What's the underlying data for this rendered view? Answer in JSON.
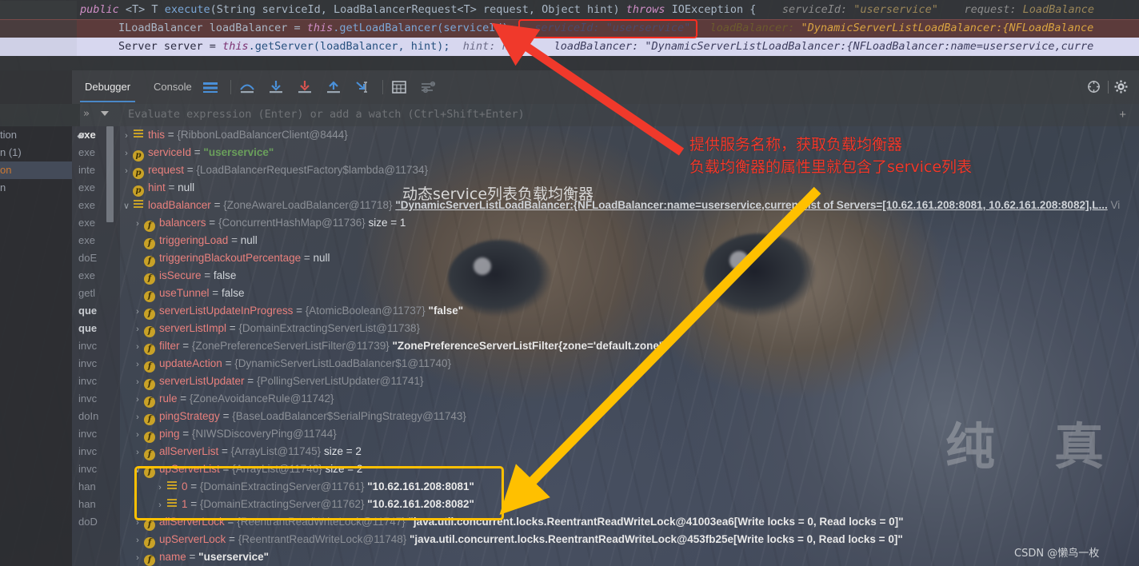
{
  "editor": {
    "line1": {
      "segments": "public <T> T execute(String serviceId, LoadBalancerRequest<T> request, Object hint) throws IOException {",
      "kw1": "public",
      "generic": " <T> T ",
      "method": "execute",
      "params": "(String serviceId, LoadBalancerRequest<T> request, Object hint) ",
      "throws": "throws",
      "tail": " IOException {",
      "inline_hint_1_label": "serviceId:",
      "inline_hint_1_value": "\"userservice\"",
      "inline_hint_2_label": "request:",
      "inline_hint_2_value": "LoadBalance"
    },
    "line2": {
      "type": "ILoadBalancer ",
      "var": "loadBalancer = ",
      "this": "this",
      "call": ".getLoadBalancer(serviceId);",
      "inline_hint_label": "serviceId:",
      "inline_hint_value": "\"userservice\"",
      "inline_hint_2_label": "loadBalancer:",
      "inline_hint_2_value": "\"DynamicServerListLoadBalancer:{NFLoadBalance"
    },
    "line3": {
      "type": "Server ",
      "var": "server = ",
      "this": "this",
      "call": ".getServer(loadBalancer, hint);",
      "hint_label": "hint:",
      "hint_value": "null",
      "lb_label": "loadBalancer:",
      "lb_value": "\"DynamicServerListLoadBalancer:{NFLoadBalancer:name=userservice,curre"
    }
  },
  "toolbar": {
    "tabs": [
      {
        "label": "Debugger",
        "active": true
      },
      {
        "label": "Console",
        "active": false
      }
    ],
    "icons": [
      "frames-icon",
      "step-over-icon",
      "step-into-icon",
      "force-step-into-icon",
      "step-out-icon",
      "run-to-cursor-icon",
      "evaluate-expression-icon",
      "settings-filter-icon"
    ],
    "right_icons": [
      "target-icon",
      "gear-icon"
    ]
  },
  "watchbar": {
    "placeholder": "Evaluate expression (Enter) or add a watch (Ctrl+Shift+Enter)",
    "chevrons": "»",
    "plus": "+"
  },
  "frames_far": [
    {
      "label": "tion",
      "selected": false
    },
    {
      "label": "n (1)",
      "selected": false
    },
    {
      "label": "on",
      "selected": true
    },
    {
      "label": "n",
      "selected": false
    }
  ],
  "frames": [
    {
      "label": "exe",
      "current": true
    },
    {
      "label": "exe",
      "current": false
    },
    {
      "label": "inte",
      "current": false
    },
    {
      "label": "exe",
      "current": false
    },
    {
      "label": "exe",
      "current": false
    },
    {
      "label": "exe",
      "current": false
    },
    {
      "label": "exe",
      "current": false
    },
    {
      "label": "doE",
      "current": false
    },
    {
      "label": "exe",
      "current": false
    },
    {
      "label": "getl",
      "current": false
    },
    {
      "label": "que",
      "current": false,
      "bold": true
    },
    {
      "label": "que",
      "current": false,
      "bold": true
    },
    {
      "label": "invc",
      "current": false
    },
    {
      "label": "invc",
      "current": false
    },
    {
      "label": "invc",
      "current": false
    },
    {
      "label": "invc",
      "current": false
    },
    {
      "label": "doIn",
      "current": false
    },
    {
      "label": "invc",
      "current": false
    },
    {
      "label": "invc",
      "current": false
    },
    {
      "label": "invc",
      "current": false
    },
    {
      "label": "han",
      "current": false
    },
    {
      "label": "han",
      "current": false
    },
    {
      "label": "doD",
      "current": false
    }
  ],
  "variables": [
    {
      "indent": 0,
      "arrow": "›",
      "icon": "object-icon",
      "name": "this",
      "eq": " = ",
      "ref": "{RibbonLoadBalancerClient@8444}",
      "value": "",
      "size": ""
    },
    {
      "indent": 0,
      "arrow": "›",
      "icon": "parameter-icon",
      "name": "serviceId",
      "eq": " = ",
      "ref": "",
      "value": "\"userservice\"",
      "value_style": "green",
      "size": ""
    },
    {
      "indent": 0,
      "arrow": "›",
      "icon": "parameter-icon",
      "name": "request",
      "eq": " = ",
      "ref": "{LoadBalancerRequestFactory$lambda@11734}",
      "value": "",
      "size": ""
    },
    {
      "indent": 0,
      "arrow": "",
      "icon": "parameter-icon",
      "name": "hint",
      "eq": " = ",
      "ref": "",
      "value": "null",
      "value_style": "plain",
      "size": ""
    },
    {
      "indent": 0,
      "arrow": "∨",
      "icon": "object-icon",
      "name": "loadBalancer",
      "eq": " = ",
      "ref": "{ZoneAwareLoadBalancer@11718}",
      "value": "\"DynamicServerListLoadBalancer:{NFLoadBalancer:name=userservice,current list of Servers=[10.62.161.208:8081, 10.62.161.208:8082],L...",
      "value_style": "link",
      "size": "",
      "tail": "Vi"
    },
    {
      "indent": 1,
      "arrow": "›",
      "icon": "field-icon",
      "name": "balancers",
      "eq": " = ",
      "ref": "{ConcurrentHashMap@11736}",
      "value": "",
      "size": "size = 1"
    },
    {
      "indent": 1,
      "arrow": "",
      "icon": "field-icon",
      "name": "triggeringLoad",
      "eq": " = ",
      "ref": "",
      "value": "null",
      "value_style": "plain",
      "size": ""
    },
    {
      "indent": 1,
      "arrow": "",
      "icon": "field-icon",
      "name": "triggeringBlackoutPercentage",
      "eq": " = ",
      "ref": "",
      "value": "null",
      "value_style": "plain",
      "size": ""
    },
    {
      "indent": 1,
      "arrow": "",
      "icon": "field-icon",
      "name": "isSecure",
      "eq": " = ",
      "ref": "",
      "value": "false",
      "value_style": "plain",
      "size": ""
    },
    {
      "indent": 1,
      "arrow": "",
      "icon": "field-icon",
      "name": "useTunnel",
      "eq": " = ",
      "ref": "",
      "value": "false",
      "value_style": "plain",
      "size": ""
    },
    {
      "indent": 1,
      "arrow": "›",
      "icon": "field-icon",
      "name": "serverListUpdateInProgress",
      "eq": " = ",
      "ref": "{AtomicBoolean@11737}",
      "value": "\"false\"",
      "value_style": "bold",
      "size": ""
    },
    {
      "indent": 1,
      "arrow": "›",
      "icon": "field-icon",
      "name": "serverListImpl",
      "eq": " = ",
      "ref": "{DomainExtractingServerList@11738}",
      "value": "",
      "size": ""
    },
    {
      "indent": 1,
      "arrow": "›",
      "icon": "field-icon",
      "name": "filter",
      "eq": " = ",
      "ref": "{ZonePreferenceServerListFilter@11739}",
      "value": "\"ZonePreferenceServerListFilter{zone='default.zone'}\"",
      "value_style": "bold",
      "size": ""
    },
    {
      "indent": 1,
      "arrow": "›",
      "icon": "field-icon",
      "name": "updateAction",
      "eq": " = ",
      "ref": "{DynamicServerListLoadBalancer$1@11740}",
      "value": "",
      "size": ""
    },
    {
      "indent": 1,
      "arrow": "›",
      "icon": "field-icon",
      "name": "serverListUpdater",
      "eq": " = ",
      "ref": "{PollingServerListUpdater@11741}",
      "value": "",
      "size": ""
    },
    {
      "indent": 1,
      "arrow": "›",
      "icon": "field-icon",
      "name": "rule",
      "eq": " = ",
      "ref": "{ZoneAvoidanceRule@11742}",
      "value": "",
      "size": ""
    },
    {
      "indent": 1,
      "arrow": "›",
      "icon": "field-icon",
      "name": "pingStrategy",
      "eq": " = ",
      "ref": "{BaseLoadBalancer$SerialPingStrategy@11743}",
      "value": "",
      "size": ""
    },
    {
      "indent": 1,
      "arrow": "›",
      "icon": "field-icon",
      "name": "ping",
      "eq": " = ",
      "ref": "{NIWSDiscoveryPing@11744}",
      "value": "",
      "size": ""
    },
    {
      "indent": 1,
      "arrow": "›",
      "icon": "field-icon",
      "name": "allServerList",
      "eq": " = ",
      "ref": "{ArrayList@11745}",
      "value": "",
      "size": "size = 2"
    },
    {
      "indent": 1,
      "arrow": "∨",
      "icon": "field-icon",
      "name": "upServerList",
      "eq": " = ",
      "ref": "{ArrayList@11746}",
      "value": "",
      "size": "size = 2"
    },
    {
      "indent": 2,
      "arrow": "›",
      "icon": "object-icon",
      "name": "0",
      "eq": " = ",
      "ref": "{DomainExtractingServer@11761}",
      "value": "\"10.62.161.208:8081\"",
      "value_style": "bold",
      "size": ""
    },
    {
      "indent": 2,
      "arrow": "›",
      "icon": "object-icon",
      "name": "1",
      "eq": " = ",
      "ref": "{DomainExtractingServer@11762}",
      "value": "\"10.62.161.208:8082\"",
      "value_style": "bold",
      "size": ""
    },
    {
      "indent": 1,
      "arrow": "›",
      "icon": "field-icon",
      "name": "allServerLock",
      "eq": " = ",
      "ref": "{ReentrantReadWriteLock@11747}",
      "value": "\"java.util.concurrent.locks.ReentrantReadWriteLock@41003ea6[Write locks = 0, Read locks = 0]\"",
      "value_style": "bold",
      "size": ""
    },
    {
      "indent": 1,
      "arrow": "›",
      "icon": "field-icon",
      "name": "upServerLock",
      "eq": " = ",
      "ref": "{ReentrantReadWriteLock@11748}",
      "value": "\"java.util.concurrent.locks.ReentrantReadWriteLock@453fb25e[Write locks = 0, Read locks = 0]\"",
      "value_style": "bold",
      "size": ""
    },
    {
      "indent": 1,
      "arrow": "›",
      "icon": "field-icon",
      "name": "name",
      "eq": " = ",
      "ref": "",
      "value": "\"userservice\"",
      "value_style": "bold",
      "size": ""
    }
  ],
  "annotations": {
    "red_line1": "提供服务名称，获取负载均衡器",
    "red_line2": "负载均衡器的属性里就包含了service列表",
    "dynamic_label": "动态service列表负载均衡器",
    "watermark": "CSDN @懒鸟一枚"
  },
  "wallpaper_text": {
    "kanji1": "纯",
    "kanji2": "真"
  },
  "colors": {
    "accent_red": "#f0392b",
    "accent_yellow": "#ffc000",
    "selection_red_border": "#ff2d20",
    "tab_underline": "#4a88c7",
    "name_color": "#e8807d",
    "string_green": "#6a9f5b"
  }
}
